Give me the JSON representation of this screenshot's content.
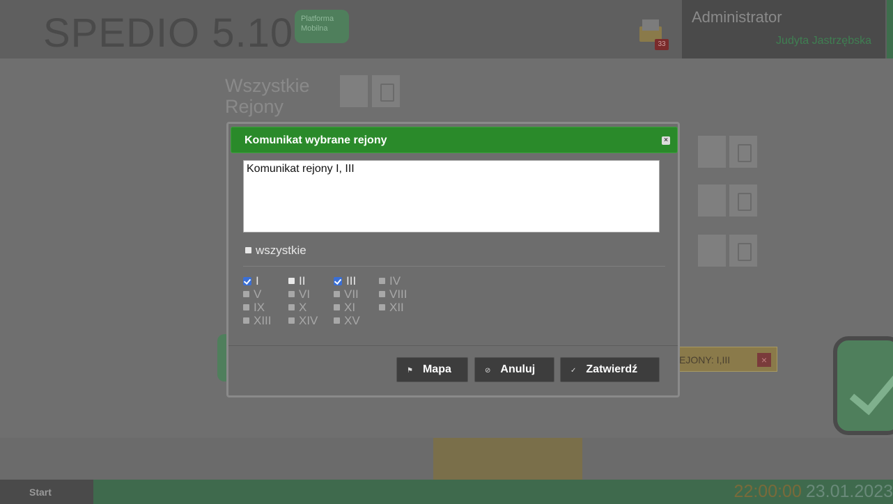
{
  "header": {
    "brand": "SPEDIO 5.10",
    "badge_line1": "Platforma",
    "badge_line2": "Mobilna",
    "mail_count": "33",
    "user_role": "Administrator",
    "user_name": "Judyta Jastrzębska"
  },
  "background": {
    "area_title_line1": "Wszystkie",
    "area_title_line2": "Rejony",
    "selected_tag": "EJONY: I,III",
    "selected_tag_close": "×"
  },
  "modal": {
    "title": "Komunikat wybrane rejony",
    "close_label": "×",
    "message": "Komunikat rejony I, III",
    "all_label": "wszystkie",
    "regions": [
      {
        "label": "I",
        "checked": true,
        "enabled": true
      },
      {
        "label": "II",
        "checked": false,
        "enabled": true
      },
      {
        "label": "III",
        "checked": true,
        "enabled": true
      },
      {
        "label": "IV",
        "checked": false,
        "enabled": false
      },
      {
        "label": "V",
        "checked": false,
        "enabled": false
      },
      {
        "label": "VI",
        "checked": false,
        "enabled": false
      },
      {
        "label": "VII",
        "checked": false,
        "enabled": false
      },
      {
        "label": "VIII",
        "checked": false,
        "enabled": false
      },
      {
        "label": "IX",
        "checked": false,
        "enabled": false
      },
      {
        "label": "X",
        "checked": false,
        "enabled": false
      },
      {
        "label": "XI",
        "checked": false,
        "enabled": false
      },
      {
        "label": "XII",
        "checked": false,
        "enabled": false
      },
      {
        "label": "XIII",
        "checked": false,
        "enabled": false
      },
      {
        "label": "XIV",
        "checked": false,
        "enabled": false
      },
      {
        "label": "XV",
        "checked": false,
        "enabled": false
      }
    ],
    "buttons": {
      "map": "Mapa",
      "cancel": "Anuluj",
      "confirm": "Zatwierdź"
    }
  },
  "taskbar": {
    "start": "Start",
    "time": "22:00:00",
    "date": "23.01.2023"
  }
}
